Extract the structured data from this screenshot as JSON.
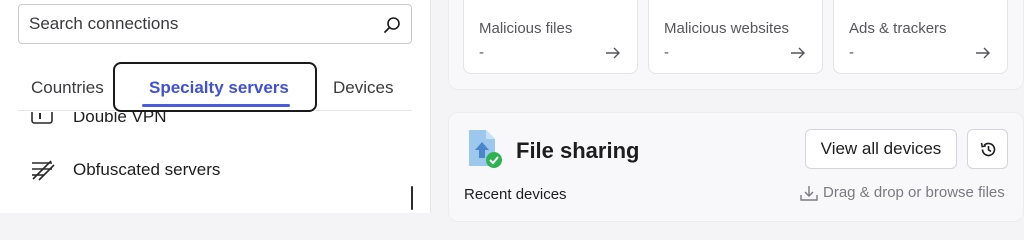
{
  "search": {
    "placeholder": "Search connections"
  },
  "tabs": [
    {
      "label": "Countries",
      "active": false
    },
    {
      "label": "Specialty servers",
      "active": true
    },
    {
      "label": "Devices",
      "active": false
    }
  ],
  "server_list": {
    "items": [
      {
        "label": "Double VPN",
        "icon": "double-vpn-icon"
      },
      {
        "label": "Obfuscated servers",
        "icon": "obfuscated-icon"
      }
    ]
  },
  "threat_stats": [
    {
      "label": "Malicious files",
      "value": "-",
      "icon": "arrow-right-icon"
    },
    {
      "label": "Malicious websites",
      "value": "-",
      "icon": "arrow-right-icon"
    },
    {
      "label": "Ads & trackers",
      "value": "-",
      "icon": "arrow-right-icon"
    }
  ],
  "file_sharing": {
    "title": "File sharing",
    "view_all_label": "View all devices",
    "history_icon": "history-icon",
    "recent_label": "Recent devices",
    "drop_text": "Drag & drop or browse files"
  },
  "colors": {
    "accent": "#4051d6",
    "focus_ring": "#1a1a1a",
    "success": "#2fb352",
    "file_icon": "#9cc8ee"
  }
}
